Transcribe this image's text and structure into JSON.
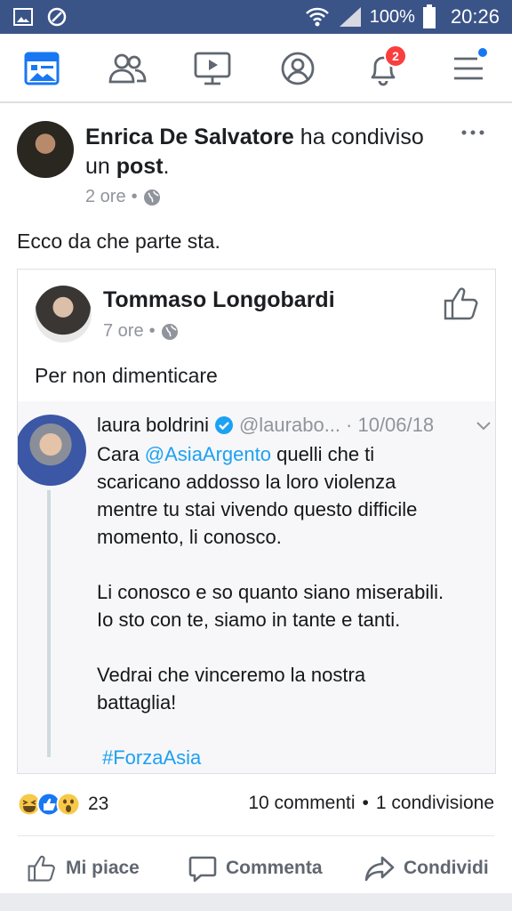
{
  "status_bar": {
    "battery_percent": "100%",
    "time": "20:26"
  },
  "nav": {
    "notifications_badge": "2"
  },
  "post": {
    "author": "Enrica De Salvatore",
    "action_text": " ha condiviso un ",
    "action_object": "post",
    "action_end": ".",
    "time": "2 ore",
    "text": "Ecco da che parte sta."
  },
  "shared_post": {
    "author": "Tommaso Longobardi",
    "time": "7 ore",
    "text": "Per non dimenticare"
  },
  "tweet": {
    "display_name": "laura boldrini",
    "handle": "@laurabo...",
    "date": "· 10/06/18",
    "line1_prefix": "Cara ",
    "mention": "@AsiaArgento",
    "line1_suffix": " quelli che ti",
    "line2": "scaricano addosso la loro violenza",
    "line3": "mentre tu stai vivendo questo difficile",
    "line4": "momento, li conosco.",
    "line5": "Li conosco e so quanto siano miserabili.",
    "line6": "Io sto con te, siamo in tante e tanti.",
    "line7": "Vedrai che vinceremo la nostra",
    "line8": "battaglia!",
    "hashtag": "#ForzaAsia"
  },
  "reactions": {
    "count": "23",
    "comments": "10 commenti",
    "separator": "•",
    "shares": "1 condivisione"
  },
  "actions": {
    "like": "Mi piace",
    "comment": "Commenta",
    "share": "Condividi"
  },
  "icons": [
    "picture-icon",
    "shield-icon",
    "wifi-icon",
    "signal-icon",
    "battery-icon",
    "news-feed-icon",
    "friends-icon",
    "video-icon",
    "profile-icon",
    "bell-icon",
    "menu-icon",
    "globe-icon",
    "more-icon",
    "thumbs-up-icon",
    "verified-icon",
    "chevron-down-icon",
    "comment-icon",
    "share-icon"
  ],
  "colors": {
    "status_bar": "#3b5488",
    "facebook_blue": "#3b5998",
    "twitter_blue": "#1da1f2",
    "badge_red": "#fa3e3e"
  }
}
